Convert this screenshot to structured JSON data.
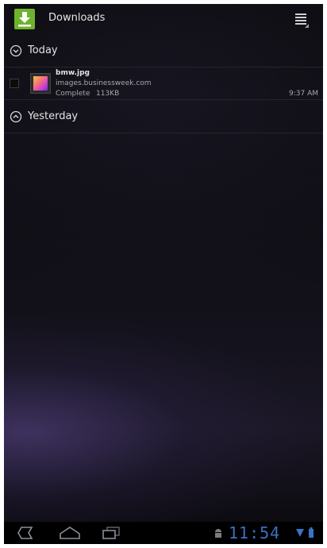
{
  "action_bar": {
    "title": "Downloads",
    "app_icon": "download-icon",
    "menu_icon": "overflow-menu-icon"
  },
  "sections": {
    "today": {
      "label": "Today",
      "icon": "chevron-down-circle-icon",
      "items": [
        {
          "name": "bmw.jpg",
          "host": "images.businessweek.com",
          "status": "Complete",
          "size": "113KB",
          "time": "9:37 AM",
          "checked": false
        }
      ]
    },
    "yesterday": {
      "label": "Yesterday",
      "icon": "chevron-up-circle-icon"
    }
  },
  "system_bar": {
    "clock": "11:54",
    "icons": [
      "back-icon",
      "home-icon",
      "recent-apps-icon",
      "android-debug-icon",
      "wifi-icon",
      "battery-icon"
    ]
  },
  "colors": {
    "accent_green": "#6fb32d",
    "clock_blue": "#3a72c4",
    "text": "#e4e4e4",
    "secondary_text": "#a8a8a8"
  }
}
